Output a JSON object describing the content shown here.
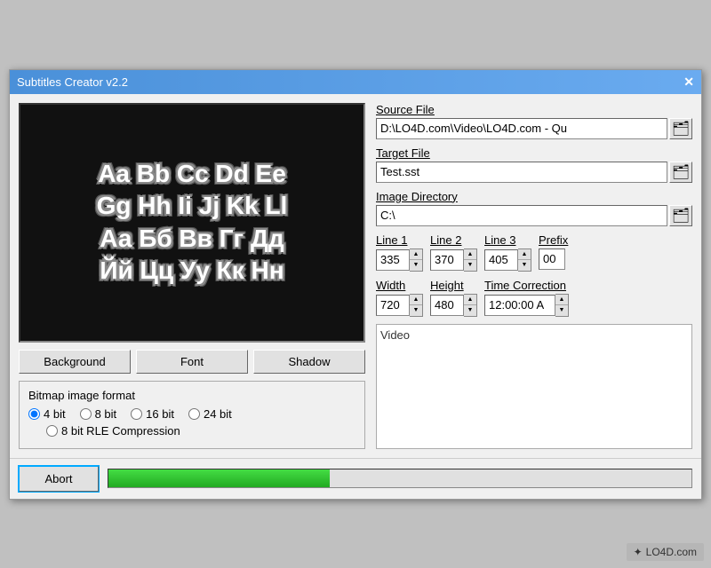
{
  "window": {
    "title": "Subtitles Creator v2.2",
    "close_label": "✕"
  },
  "preview": {
    "text": "Aa Bb Cc Dd Ee\nGg Hh Ii Jj Kk Ll\nАа Бб Вв Гг Дд\nЙй Цц Уу Кк Нн"
  },
  "buttons": {
    "background": "Background",
    "font": "Font",
    "shadow": "Shadow",
    "abort": "Abort"
  },
  "bitmap": {
    "label": "Bitmap image format",
    "options": [
      "4 bit",
      "8 bit",
      "16 bit",
      "24 bit"
    ],
    "selected": "4 bit",
    "rle_label": "8 bit RLE Compression"
  },
  "source_file": {
    "label": "Source File",
    "value": "D:\\LO4D.com\\Video\\LO4D.com - Qu",
    "browse_icon": "🗂"
  },
  "target_file": {
    "label": "Target File",
    "value": "Test.sst",
    "browse_icon": "🗂"
  },
  "image_directory": {
    "label": "Image Directory",
    "value": "C:\\",
    "browse_icon": "🗂"
  },
  "line1": {
    "label": "Line 1",
    "value": "335"
  },
  "line2": {
    "label": "Line 2",
    "value": "370"
  },
  "line3": {
    "label": "Line 3",
    "value": "405"
  },
  "prefix": {
    "label": "Prefix",
    "value": "00"
  },
  "width": {
    "label": "Width",
    "value": "720"
  },
  "height": {
    "label": "Height",
    "value": "480"
  },
  "time_correction": {
    "label": "Time Correction",
    "value": "12:00:00 A"
  },
  "video": {
    "label": "Video"
  },
  "progress": {
    "percent": 38
  },
  "watermark": {
    "text": "✦ LO4D.com"
  }
}
